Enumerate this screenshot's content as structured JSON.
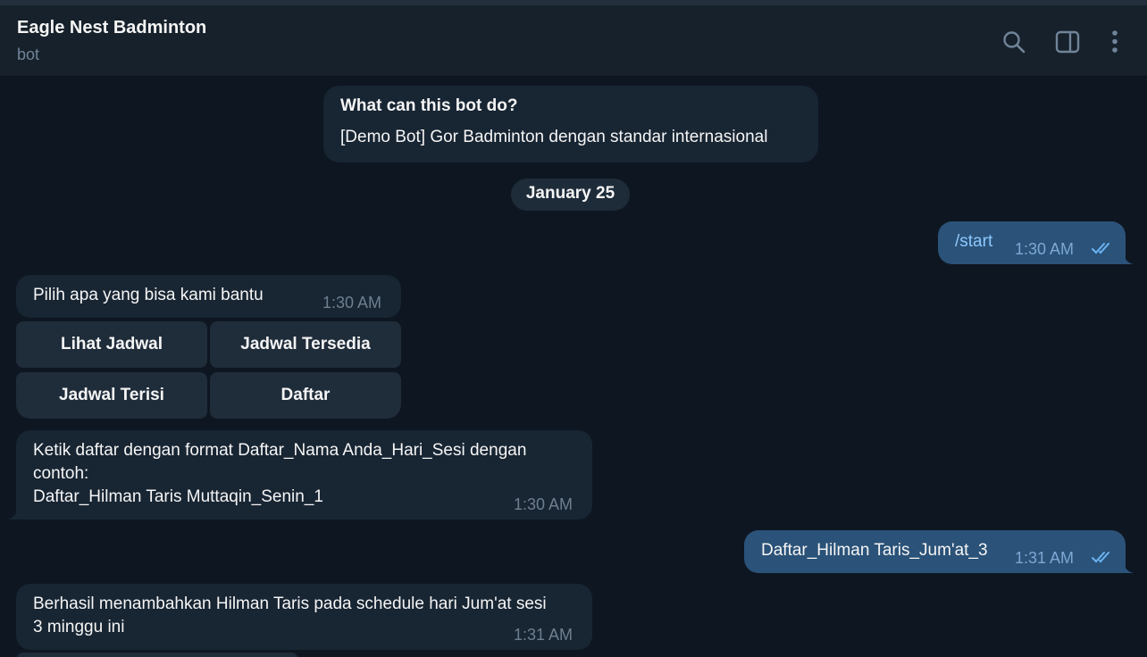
{
  "header": {
    "title": "Eagle Nest Badminton",
    "subtitle": "bot",
    "icons": [
      "search-icon",
      "sidebar-toggle-icon",
      "more-vertical-icon"
    ]
  },
  "bot_info": {
    "question": "What can this bot do?",
    "description": "[Demo Bot] Gor Badminton dengan standar internasional"
  },
  "date_separator": "January 25",
  "messages": [
    {
      "direction": "out",
      "text": "/start",
      "time": "1:30 AM",
      "status": "read"
    },
    {
      "direction": "in",
      "text": "Pilih apa yang bisa kami bantu",
      "time": "1:30 AM"
    },
    {
      "direction": "in",
      "text": "Ketik daftar dengan format Daftar_Nama Anda_Hari_Sesi dengan contoh:\nDaftar_Hilman Taris Muttaqin_Senin_1",
      "time": "1:30 AM"
    },
    {
      "direction": "out",
      "text": "Daftar_Hilman Taris_Jum'at_3",
      "time": "1:31 AM",
      "status": "read"
    },
    {
      "direction": "in",
      "text": "Berhasil menambahkan Hilman Taris pada schedule hari Jum'at sesi 3 minggu ini",
      "time": "1:31 AM"
    }
  ],
  "inline_keyboard": [
    [
      "Lihat Jadwal",
      "Jadwal Tersedia"
    ],
    [
      "Jadwal Terisi",
      "Daftar"
    ]
  ],
  "colors": {
    "background": "#0e1621",
    "header": "#17212b",
    "incoming_bubble": "#182533",
    "outgoing_bubble": "#2b5278",
    "check_marks": "#6ab3f3"
  }
}
